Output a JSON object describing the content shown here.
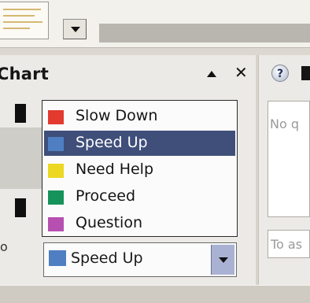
{
  "task_pane": {
    "title": "Chart"
  },
  "dropdown": {
    "options": [
      {
        "label": "Slow Down",
        "color": "#e23a2f"
      },
      {
        "label": "Speed Up",
        "color": "#4f7fc2",
        "selected": true
      },
      {
        "label": "Need Help",
        "color": "#ecd722"
      },
      {
        "label": "Proceed",
        "color": "#16925b"
      },
      {
        "label": "Question",
        "color": "#b64fb0"
      }
    ]
  },
  "combo": {
    "value": "Speed Up",
    "color": "#4f7fc2"
  },
  "right_pane": {
    "list_placeholder": "No q",
    "input_placeholder": "To as"
  },
  "left_stub_text": "o"
}
